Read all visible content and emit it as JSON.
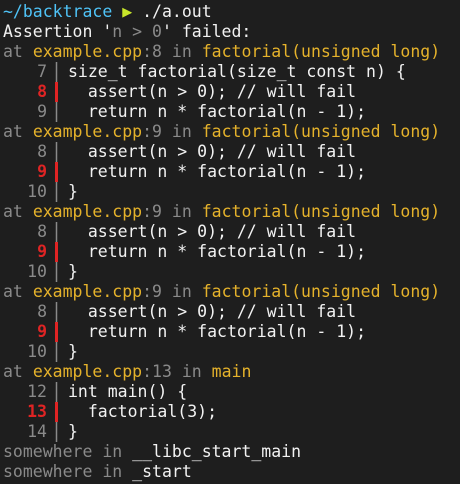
{
  "prompt": {
    "path": "~/backtrace",
    "arrow": "▶",
    "command": "./a.out"
  },
  "assertion": {
    "prefix": "Assertion '",
    "condition": "n > 0",
    "suffix": "' failed:"
  },
  "frames": [
    {
      "at": "at",
      "file": "example.cpp",
      "sep": ":",
      "line": "8",
      "in": "in",
      "function": "factorial(unsigned long)",
      "source": [
        {
          "no": "7",
          "text": "size_t factorial(size_t const n) {",
          "highlight": false
        },
        {
          "no": "8",
          "text": "  assert(n > 0); // will fail",
          "highlight": true
        },
        {
          "no": "9",
          "text": "  return n * factorial(n - 1);",
          "highlight": false
        }
      ]
    },
    {
      "at": "at",
      "file": "example.cpp",
      "sep": ":",
      "line": "9",
      "in": "in",
      "function": "factorial(unsigned long)",
      "source": [
        {
          "no": "8",
          "text": "  assert(n > 0); // will fail",
          "highlight": false
        },
        {
          "no": "9",
          "text": "  return n * factorial(n - 1);",
          "highlight": true
        },
        {
          "no": "10",
          "text": "}",
          "highlight": false
        }
      ]
    },
    {
      "at": "at",
      "file": "example.cpp",
      "sep": ":",
      "line": "9",
      "in": "in",
      "function": "factorial(unsigned long)",
      "source": [
        {
          "no": "8",
          "text": "  assert(n > 0); // will fail",
          "highlight": false
        },
        {
          "no": "9",
          "text": "  return n * factorial(n - 1);",
          "highlight": true
        },
        {
          "no": "10",
          "text": "}",
          "highlight": false
        }
      ]
    },
    {
      "at": "at",
      "file": "example.cpp",
      "sep": ":",
      "line": "9",
      "in": "in",
      "function": "factorial(unsigned long)",
      "source": [
        {
          "no": "8",
          "text": "  assert(n > 0); // will fail",
          "highlight": false
        },
        {
          "no": "9",
          "text": "  return n * factorial(n - 1);",
          "highlight": true
        },
        {
          "no": "10",
          "text": "}",
          "highlight": false
        }
      ]
    },
    {
      "at": "at",
      "file": "example.cpp",
      "sep": ":",
      "line": "13",
      "in": "in",
      "function": "main",
      "source": [
        {
          "no": "12",
          "text": "int main() {",
          "highlight": false
        },
        {
          "no": "13",
          "text": "  factorial(3);",
          "highlight": true
        },
        {
          "no": "14",
          "text": "}",
          "highlight": false
        }
      ]
    }
  ],
  "unknown_frames": [
    {
      "where": "somewhere",
      "in": "in",
      "function": "__libc_start_main"
    },
    {
      "where": "somewhere",
      "in": "in",
      "function": "_start"
    }
  ],
  "colors": {
    "background": "#1e1e1e",
    "prompt_path": "#4fc3f7",
    "prompt_arrow": "#c8e62a",
    "highlight": "#e02424",
    "location": "#e5b22b",
    "muted": "#8a8a8a"
  }
}
